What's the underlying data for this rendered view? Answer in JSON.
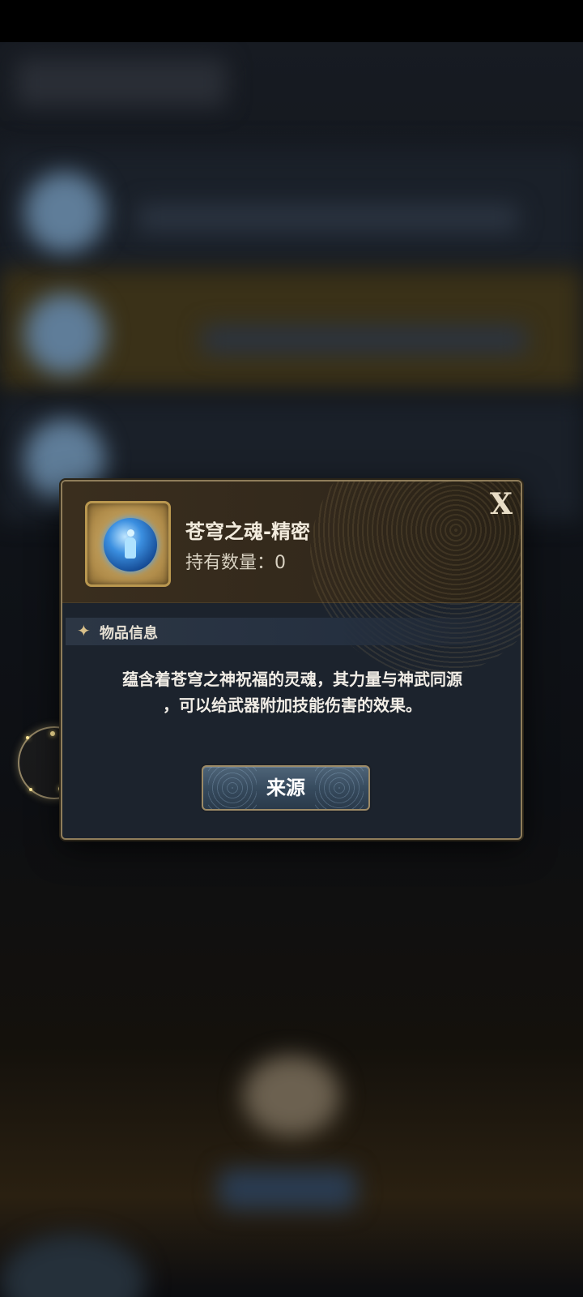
{
  "item": {
    "name": "苍穹之魂-精密",
    "count_text": "持有数量：0",
    "icon": "blue-soul-orb-icon"
  },
  "info": {
    "section_title": "物品信息",
    "description_line1": "蕴含着苍穹之神祝福的灵魂，其力量与神武同源",
    "description_line2": "，可以给武器附加技能伤害的效果。"
  },
  "actions": {
    "close_label": "X",
    "source_label": "来源"
  },
  "colors": {
    "accent_gold": "#b9974f",
    "button_blue": "#35495c"
  }
}
